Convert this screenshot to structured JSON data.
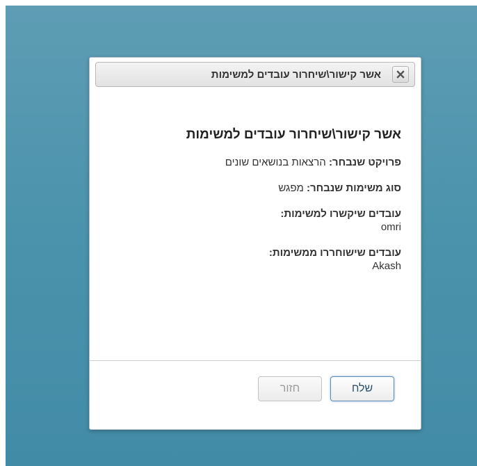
{
  "dialog": {
    "titlebar_title": "אשר קישור\\שיחרור עובדים למשימות",
    "heading": "אשר קישור\\שיחרור עובדים למשימות",
    "project": {
      "label": "פרויקט שנבחר:",
      "value": "הרצאות בנושאים שונים"
    },
    "task_type": {
      "label": "סוג משימות שנבחר:",
      "value": "מפגש"
    },
    "assigned": {
      "label": "עובדים שיקשרו למשימות:",
      "value": "omri"
    },
    "released": {
      "label": "עובדים שישוחררו ממשימות:",
      "value": "Akash"
    },
    "buttons": {
      "send_label": "שלח",
      "back_label": "חזור"
    }
  }
}
